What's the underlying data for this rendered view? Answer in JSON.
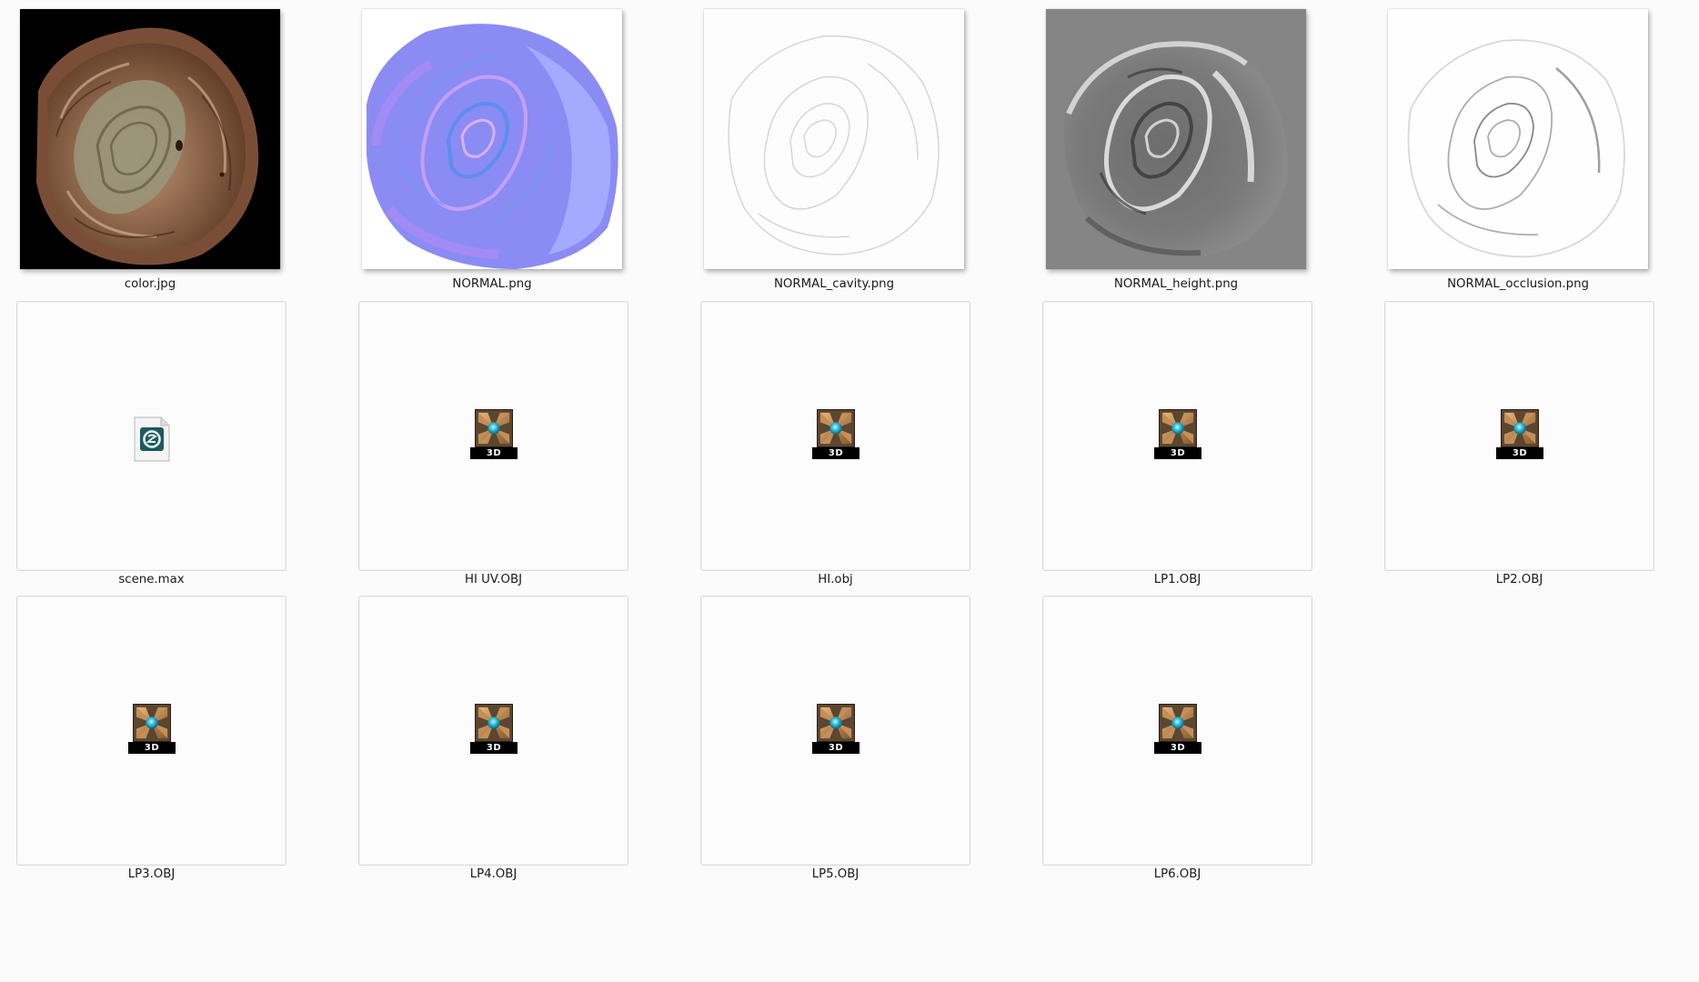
{
  "files": [
    {
      "name": "color.jpg",
      "kind": "image-color"
    },
    {
      "name": "NORMAL.png",
      "kind": "image-normal"
    },
    {
      "name": "NORMAL_cavity.png",
      "kind": "image-cavity"
    },
    {
      "name": "NORMAL_height.png",
      "kind": "image-height"
    },
    {
      "name": "NORMAL_occlusion.png",
      "kind": "image-occlusion"
    },
    {
      "name": "scene.max",
      "kind": "max-file",
      "icon": "3ds-max-file-icon"
    },
    {
      "name": "HI UV.OBJ",
      "kind": "obj",
      "icon": "3d-object-icon",
      "badge": "3D"
    },
    {
      "name": "HI.obj",
      "kind": "obj",
      "icon": "3d-object-icon",
      "badge": "3D"
    },
    {
      "name": "LP1.OBJ",
      "kind": "obj",
      "icon": "3d-object-icon",
      "badge": "3D"
    },
    {
      "name": "LP2.OBJ",
      "kind": "obj",
      "icon": "3d-object-icon",
      "badge": "3D"
    },
    {
      "name": "LP3.OBJ",
      "kind": "obj",
      "icon": "3d-object-icon",
      "badge": "3D"
    },
    {
      "name": "LP4.OBJ",
      "kind": "obj",
      "icon": "3d-object-icon",
      "badge": "3D"
    },
    {
      "name": "LP5.OBJ",
      "kind": "obj",
      "icon": "3d-object-icon",
      "badge": "3D"
    },
    {
      "name": "LP6.OBJ",
      "kind": "obj",
      "icon": "3d-object-icon",
      "badge": "3D"
    }
  ]
}
